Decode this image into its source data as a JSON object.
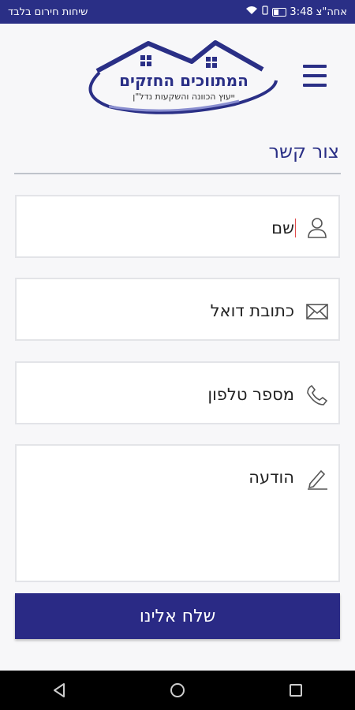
{
  "status_bar": {
    "left_text": "שיחות חירום בלבד",
    "time": "3:48",
    "carrier": "אחה\"צ"
  },
  "header": {
    "logo_title": "המתווכים החזקים",
    "logo_subtitle": "ייעוץ הכוונה והשקעות נדל\"ן"
  },
  "page": {
    "title": "צור קשר"
  },
  "form": {
    "name_placeholder": "שם",
    "email_placeholder": "כתובת דואל",
    "phone_placeholder": "מספר טלפון",
    "message_placeholder": "הודעה",
    "submit_label": "שלח אלינו"
  },
  "colors": {
    "primary": "#2a2f86",
    "field_border": "#e3e4e8",
    "background": "#f7f7f9"
  }
}
